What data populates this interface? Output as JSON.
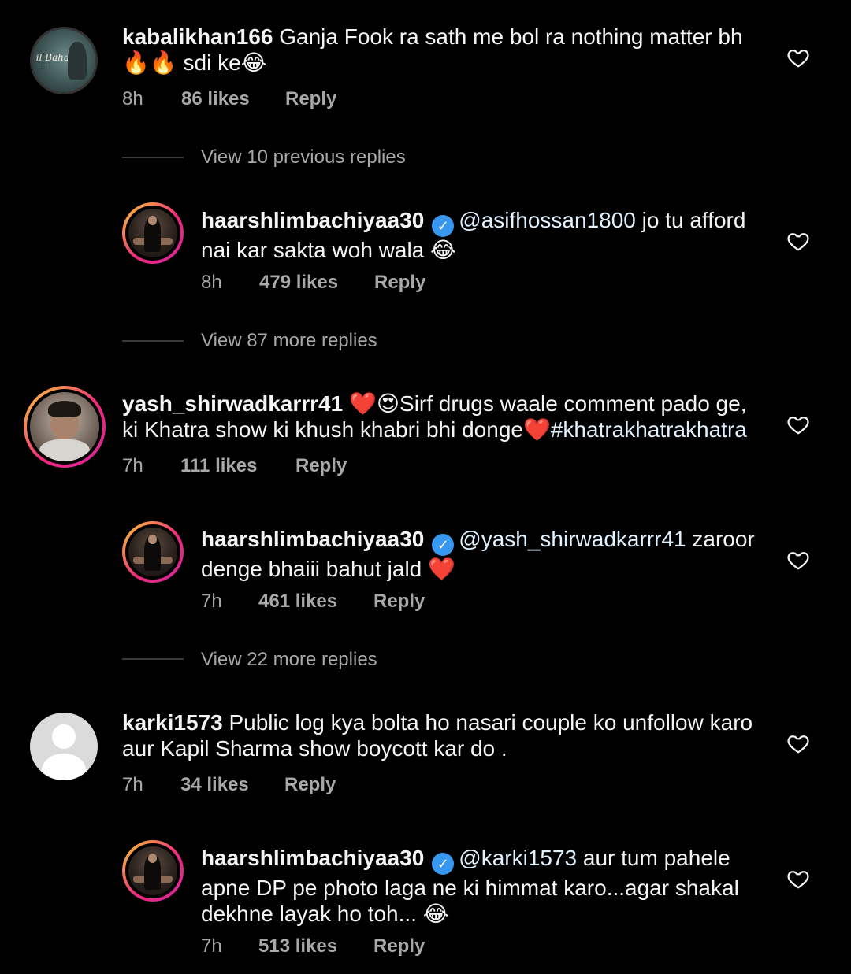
{
  "comments": [
    {
      "username": "kabalikhan166",
      "text": "Ganja Fook ra sath me bol ra nothing matter bh🔥🔥 sdi ke😂",
      "time": "8h",
      "likes": "86 likes",
      "reply": "Reply",
      "avatar_text": "il Baharu"
    },
    {
      "username": "yash_shirwadkarrr41",
      "text": "❤️😍Sirf drugs waale comment pado ge, ki Khatra show ki khush khabri bhi donge❤️",
      "hashtag": "#khatrakhatrakhatra",
      "time": "7h",
      "likes": "111 likes",
      "reply": "Reply"
    },
    {
      "username": "karki1573",
      "text": "Public log kya bolta ho  nasari couple ko unfollow karo aur Kapil Sharma show boycott kar do .",
      "time": "7h",
      "likes": "34 likes",
      "reply": "Reply"
    }
  ],
  "replies": [
    {
      "username": "haarshlimbachiyaa30",
      "mention": "@asifhossan1800",
      "text": " jo tu afford nai kar sakta woh wala 😂",
      "time": "8h",
      "likes": "479 likes",
      "reply": "Reply"
    },
    {
      "username": "haarshlimbachiyaa30",
      "mention": "@yash_shirwadkarrr41",
      "text": "  zaroor denge bhaiii bahut jald ❤️",
      "time": "7h",
      "likes": "461 likes",
      "reply": "Reply"
    },
    {
      "username": "haarshlimbachiyaa30",
      "mention": "@karki1573",
      "text": " aur tum pahele apne DP pe photo laga ne ki himmat karo...agar shakal dekhne layak ho toh... 😂",
      "time": "7h",
      "likes": "513 likes",
      "reply": "Reply"
    }
  ],
  "view_more": [
    "View 10 previous replies",
    "View 87 more replies",
    "View 22 more replies"
  ],
  "icons": {
    "verified": "verified-badge-icon",
    "like": "heart-icon"
  },
  "colors": {
    "background": "#000000",
    "text": "#f5f5f5",
    "muted": "#a8a8a8",
    "verified": "#3897f0"
  }
}
